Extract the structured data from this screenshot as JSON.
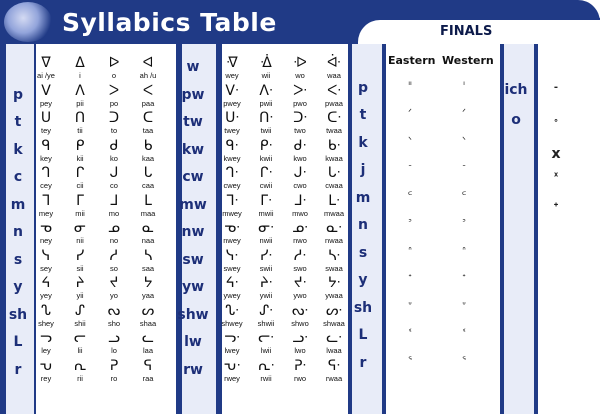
{
  "title": "Syllabics Table",
  "finals_title": "FINALS",
  "finals_headers": [
    "Eastern",
    "Western"
  ],
  "colors": {
    "frame": "#203a86",
    "accent": "#1d2f78",
    "background": "#ffffff"
  },
  "left_consonants": [
    "p",
    "t",
    "k",
    "c",
    "m",
    "n",
    "s",
    "y",
    "sh",
    "L",
    "r"
  ],
  "mid_consonants": [
    "w",
    "pw",
    "tw",
    "kw",
    "cw",
    "mw",
    "nw",
    "sw",
    "yw",
    "shw",
    "lw",
    "rw"
  ],
  "finals_consonants": [
    "p",
    "t",
    "k",
    "j",
    "m",
    "n",
    "s",
    "y",
    "sh",
    "L",
    "r"
  ],
  "extra_labels": [
    "ich",
    "o"
  ],
  "rows_left": [
    [
      [
        "ᐁ",
        "ai /ye"
      ],
      [
        "ᐃ",
        "i"
      ],
      [
        "ᐅ",
        "o"
      ],
      [
        "ᐊ",
        "ah /u"
      ]
    ],
    [
      [
        "ᐯ",
        "pey"
      ],
      [
        "ᐱ",
        "pii"
      ],
      [
        "ᐳ",
        "po"
      ],
      [
        "ᐸ",
        "paa"
      ]
    ],
    [
      [
        "ᑌ",
        "tey"
      ],
      [
        "ᑎ",
        "tii"
      ],
      [
        "ᑐ",
        "to"
      ],
      [
        "ᑕ",
        "taa"
      ]
    ],
    [
      [
        "ᑫ",
        "key"
      ],
      [
        "ᑭ",
        "kii"
      ],
      [
        "ᑯ",
        "ko"
      ],
      [
        "ᑲ",
        "kaa"
      ]
    ],
    [
      [
        "ᒉ",
        "cey"
      ],
      [
        "ᒋ",
        "cii"
      ],
      [
        "ᒍ",
        "co"
      ],
      [
        "ᒐ",
        "caa"
      ]
    ],
    [
      [
        "ᒣ",
        "mey"
      ],
      [
        "ᒥ",
        "mii"
      ],
      [
        "ᒧ",
        "mo"
      ],
      [
        "ᒪ",
        "maa"
      ]
    ],
    [
      [
        "ᓀ",
        "ney"
      ],
      [
        "ᓂ",
        "nii"
      ],
      [
        "ᓄ",
        "no"
      ],
      [
        "ᓇ",
        "naa"
      ]
    ],
    [
      [
        "ᓭ",
        "sey"
      ],
      [
        "ᓯ",
        "sii"
      ],
      [
        "ᓱ",
        "so"
      ],
      [
        "ᓴ",
        "saa"
      ]
    ],
    [
      [
        "ᔦ",
        "yey"
      ],
      [
        "ᔨ",
        "yii"
      ],
      [
        "ᔪ",
        "yo"
      ],
      [
        "ᔭ",
        "yaa"
      ]
    ],
    [
      [
        "ᔐ",
        "shey"
      ],
      [
        "ᔑ",
        "shii"
      ],
      [
        "ᔓ",
        "sho"
      ],
      [
        "ᔕ",
        "shaa"
      ]
    ],
    [
      [
        "ᓓ",
        "ley"
      ],
      [
        "ᓕ",
        "lii"
      ],
      [
        "ᓗ",
        "lo"
      ],
      [
        "ᓚ",
        "laa"
      ]
    ],
    [
      [
        "ᕃ",
        "rey"
      ],
      [
        "ᕆ",
        "rii"
      ],
      [
        "ᕈ",
        "ro"
      ],
      [
        "ᕋ",
        "raa"
      ]
    ]
  ],
  "rows_mid": [
    [
      [
        "ᐌ",
        "wey"
      ],
      [
        "ᐐ",
        "wii"
      ],
      [
        "ᐒ",
        "wo"
      ],
      [
        "ᐚ",
        "waa"
      ]
    ],
    [
      [
        "ᐯᐧ",
        "pwey"
      ],
      [
        "ᐱᐧ",
        "pwii"
      ],
      [
        "ᐳᐧ",
        "pwo"
      ],
      [
        "ᐸᐧ",
        "pwaa"
      ]
    ],
    [
      [
        "ᑌᐧ",
        "twey"
      ],
      [
        "ᑎᐧ",
        "twii"
      ],
      [
        "ᑐᐧ",
        "two"
      ],
      [
        "ᑕᐧ",
        "twaa"
      ]
    ],
    [
      [
        "ᑫᐧ",
        "kwey"
      ],
      [
        "ᑭᐧ",
        "kwii"
      ],
      [
        "ᑯᐧ",
        "kwo"
      ],
      [
        "ᑲᐧ",
        "kwaa"
      ]
    ],
    [
      [
        "ᒉᐧ",
        "cwey"
      ],
      [
        "ᒋᐧ",
        "cwii"
      ],
      [
        "ᒍᐧ",
        "cwo"
      ],
      [
        "ᒐᐧ",
        "cwaa"
      ]
    ],
    [
      [
        "ᒣᐧ",
        "mwey"
      ],
      [
        "ᒥᐧ",
        "mwii"
      ],
      [
        "ᒧᐧ",
        "mwo"
      ],
      [
        "ᒪᐧ",
        "mwaa"
      ]
    ],
    [
      [
        "ᓀᐧ",
        "nwey"
      ],
      [
        "ᓂᐧ",
        "nwii"
      ],
      [
        "ᓄᐧ",
        "nwo"
      ],
      [
        "ᓇᐧ",
        "nwaa"
      ]
    ],
    [
      [
        "ᓭᐧ",
        "swey"
      ],
      [
        "ᓯᐧ",
        "swii"
      ],
      [
        "ᓱᐧ",
        "swo"
      ],
      [
        "ᓴᐧ",
        "swaa"
      ]
    ],
    [
      [
        "ᔦᐧ",
        "ywey"
      ],
      [
        "ᔨᐧ",
        "ywii"
      ],
      [
        "ᔪᐧ",
        "ywo"
      ],
      [
        "ᔭᐧ",
        "ywaa"
      ]
    ],
    [
      [
        "ᔐᐧ",
        "shwey"
      ],
      [
        "ᔑᐧ",
        "shwii"
      ],
      [
        "ᔓᐧ",
        "shwo"
      ],
      [
        "ᔕᐧ",
        "shwaa"
      ]
    ],
    [
      [
        "ᓓᐧ",
        "lwey"
      ],
      [
        "ᓕᐧ",
        "lwii"
      ],
      [
        "ᓗᐧ",
        "lwo"
      ],
      [
        "ᓚᐧ",
        "lwaa"
      ]
    ],
    [
      [
        "ᕃᐧ",
        "rwey"
      ],
      [
        "ᕆᐧ",
        "rwii"
      ],
      [
        "ᕈᐧ",
        "rwo"
      ],
      [
        "ᕋᐧ",
        "rwaa"
      ]
    ]
  ],
  "finals_rows": [
    [
      "ᐦ",
      "ᑊ"
    ],
    [
      "ᐟ",
      "ᐟ"
    ],
    [
      "ᐠ",
      "ᐠ"
    ],
    [
      "ᐨ",
      "ᐨ"
    ],
    [
      "ᒼ",
      "ᒼ"
    ],
    [
      "ᐣ",
      "ᐣ"
    ],
    [
      "ᐢ",
      "ᐢ"
    ],
    [
      "ᐩ",
      "ᐩ"
    ],
    [
      "ᐡ",
      "ᐡ"
    ],
    [
      "ᓫ",
      "ᓫ"
    ],
    [
      "ᕐ",
      "ᕐ"
    ]
  ],
  "extra_glyphs": [
    "-",
    "ᐤ",
    "x",
    "ᕽ",
    "ᐩ"
  ]
}
